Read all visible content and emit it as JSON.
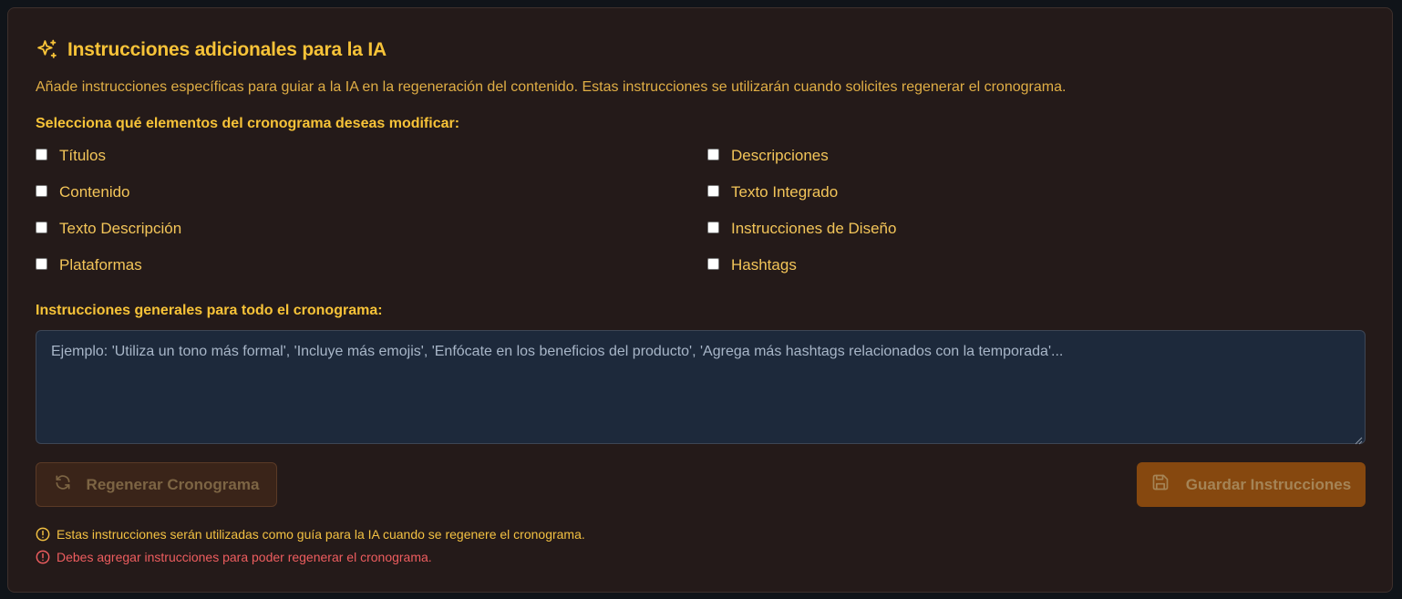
{
  "header": {
    "title": "Instrucciones adicionales para la IA",
    "description": "Añade instrucciones específicas para guiar a la IA en la regeneración del contenido. Estas instrucciones se utilizarán cuando solicites regenerar el cronograma.",
    "icon": "sparkles-icon"
  },
  "elements_section": {
    "label": "Selecciona qué elementos del cronograma deseas modificar:",
    "options": [
      {
        "label": "Títulos",
        "checked": false
      },
      {
        "label": "Descripciones",
        "checked": false
      },
      {
        "label": "Contenido",
        "checked": false
      },
      {
        "label": "Texto Integrado",
        "checked": false
      },
      {
        "label": "Texto Descripción",
        "checked": false
      },
      {
        "label": "Instrucciones de Diseño",
        "checked": false
      },
      {
        "label": "Plataformas",
        "checked": false
      },
      {
        "label": "Hashtags",
        "checked": false
      }
    ]
  },
  "general_section": {
    "label": "Instrucciones generales para todo el cronograma:",
    "value": "",
    "placeholder": "Ejemplo: 'Utiliza un tono más formal', 'Incluye más emojis', 'Enfócate en los beneficios del producto', 'Agrega más hashtags relacionados con la temporada'..."
  },
  "actions": {
    "regenerate_label": "Regenerar Cronograma",
    "regenerate_icon": "refresh-icon",
    "save_label": "Guardar Instrucciones",
    "save_icon": "save-icon"
  },
  "notes": {
    "info": "Estas instrucciones serán utilizadas como guía para la IA cuando se regenere el cronograma.",
    "error": "Debes agregar instrucciones para poder regenerar el cronograma."
  },
  "colors": {
    "accent": "#f7c338",
    "error": "#ee5d5f",
    "panel_bg": "#241a19",
    "textarea_bg": "#1d293b",
    "save_button_bg": "#86480f"
  }
}
